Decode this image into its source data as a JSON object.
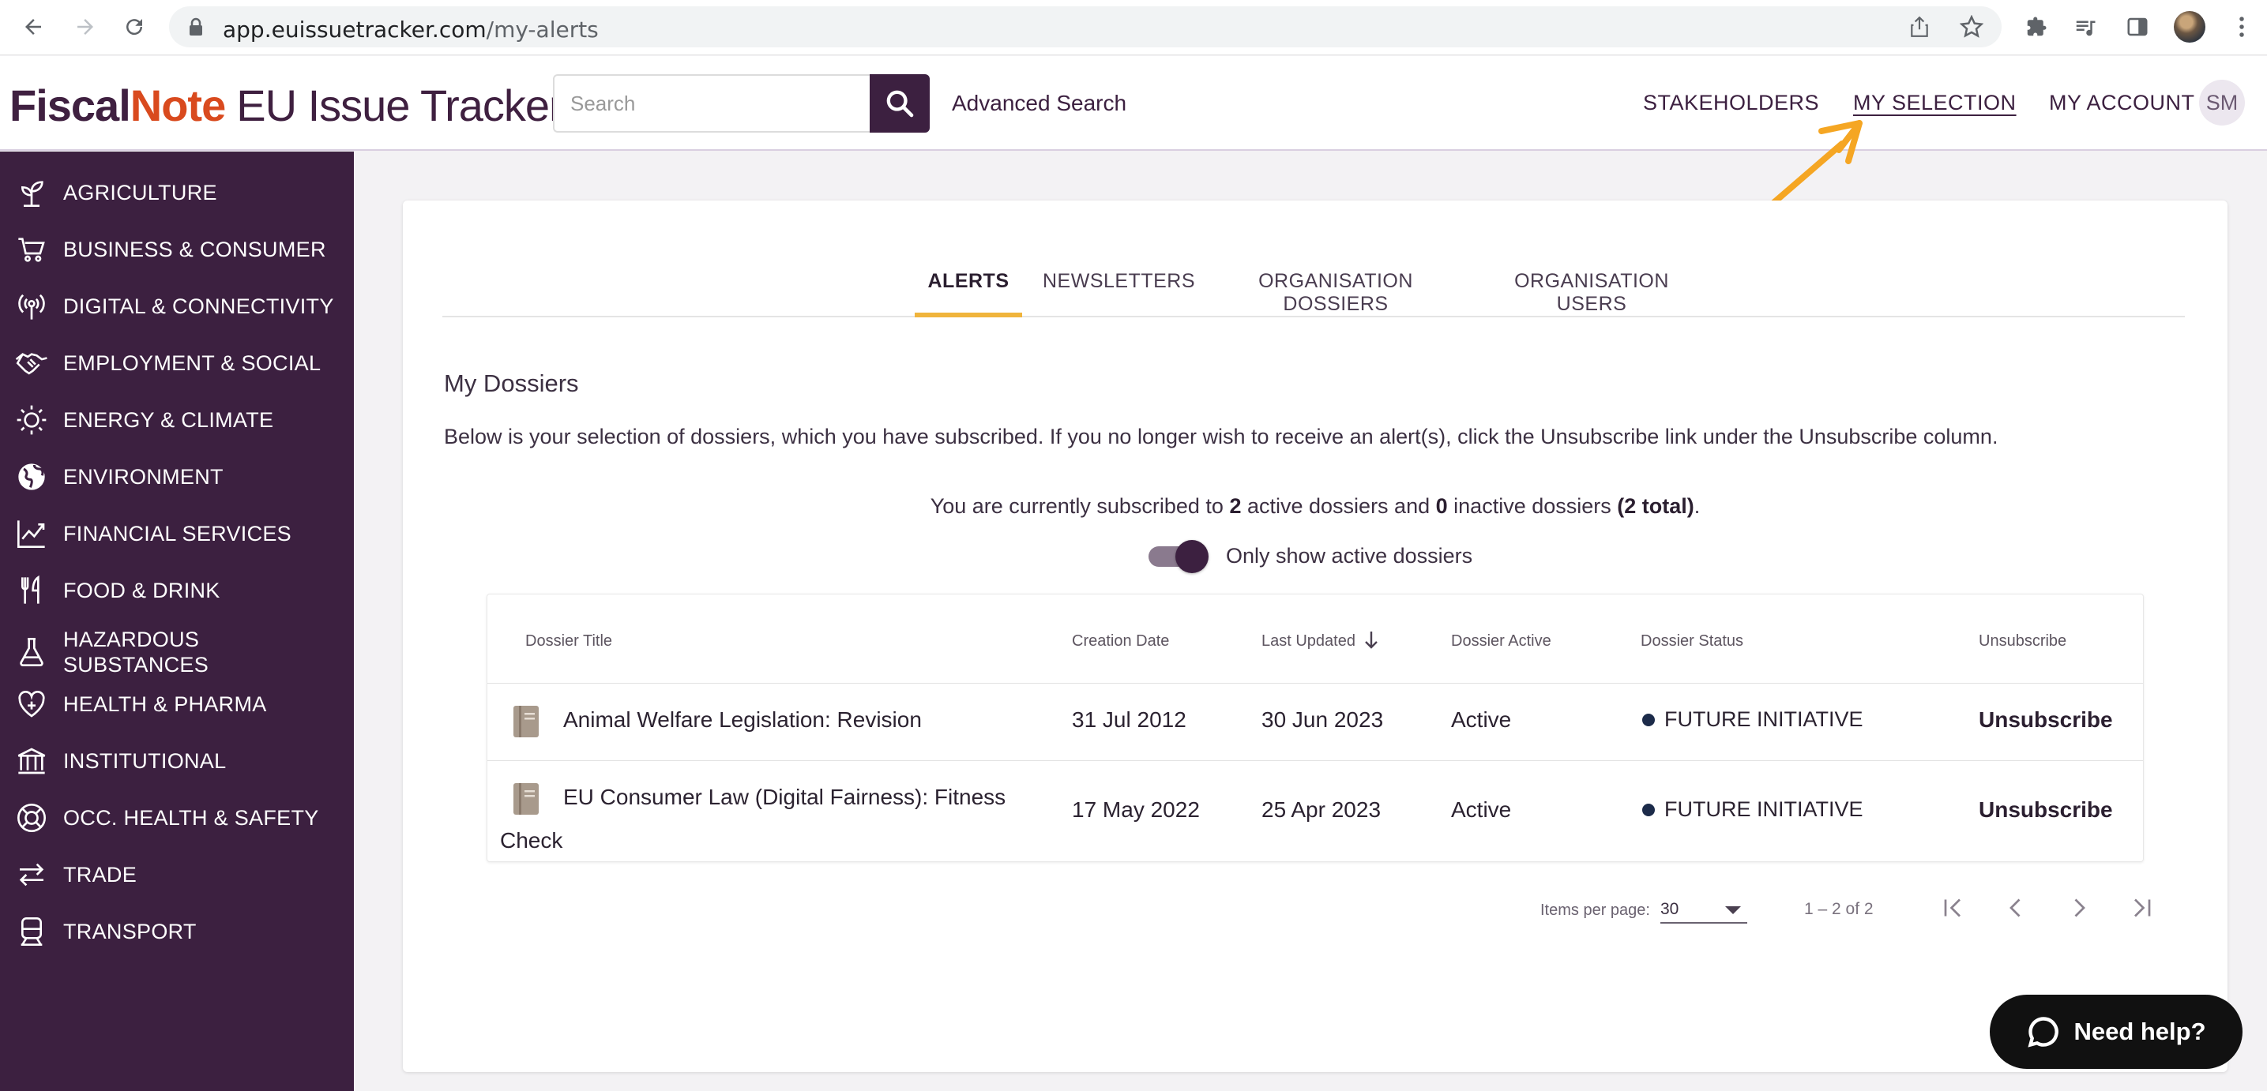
{
  "browser": {
    "url_host": "app.euissuetracker.com",
    "url_path": "/my-alerts"
  },
  "header": {
    "logo_fiscal": "Fiscal",
    "logo_note": "Note",
    "logo_rest": "EU Issue Tracker",
    "search_placeholder": "Search",
    "advanced_search": "Advanced Search",
    "nav": {
      "stakeholders": "STAKEHOLDERS",
      "my_selection": "MY SELECTION",
      "my_account": "MY ACCOUNT"
    },
    "avatar_initials": "SM"
  },
  "sidebar": {
    "items": [
      {
        "label": "AGRICULTURE",
        "icon": "sprout-icon"
      },
      {
        "label": "BUSINESS & CONSUMER",
        "icon": "cart-icon"
      },
      {
        "label": "DIGITAL & CONNECTIVITY",
        "icon": "broadcast-icon"
      },
      {
        "label": "EMPLOYMENT & SOCIAL",
        "icon": "handshake-icon"
      },
      {
        "label": "ENERGY & CLIMATE",
        "icon": "sun-gear-icon"
      },
      {
        "label": "ENVIRONMENT",
        "icon": "globe-icon"
      },
      {
        "label": "FINANCIAL SERVICES",
        "icon": "chart-icon"
      },
      {
        "label": "FOOD & DRINK",
        "icon": "cutlery-icon"
      },
      {
        "label": "HAZARDOUS SUBSTANCES",
        "icon": "flask-icon"
      },
      {
        "label": "HEALTH & PHARMA",
        "icon": "heart-plus-icon"
      },
      {
        "label": "INSTITUTIONAL",
        "icon": "building-icon"
      },
      {
        "label": "OCC. HEALTH & SAFETY",
        "icon": "lifebuoy-icon"
      },
      {
        "label": "TRADE",
        "icon": "exchange-arrows-icon"
      },
      {
        "label": "TRANSPORT",
        "icon": "train-icon"
      }
    ]
  },
  "tabs": [
    {
      "label": "ALERTS",
      "active": true
    },
    {
      "label": "NEWSLETTERS",
      "active": false
    },
    {
      "label": "ORGANISATION DOSSIERS",
      "active": false
    },
    {
      "label": "ORGANISATION USERS",
      "active": false
    }
  ],
  "content": {
    "title": "My Dossiers",
    "description": "Below is your selection of dossiers, which you have subscribed. If you no longer wish to receive an alert(s), click the Unsubscribe link under the Unsubscribe column.",
    "summary": {
      "prefix": "You are currently subscribed to",
      "active_count": "2",
      "active_text": "active dossiers and",
      "inactive_count": "0",
      "inactive_text": "inactive dossiers",
      "total": "(2 total)",
      "suffix": "."
    },
    "toggle_label": "Only show active dossiers",
    "toggle_on": true
  },
  "table": {
    "columns": [
      "Dossier Title",
      "Creation Date",
      "Last Updated",
      "Dossier Active",
      "Dossier Status",
      "Unsubscribe"
    ],
    "rows": [
      {
        "title_line1": "Animal Welfare Legislation: Revision",
        "title_line2": "",
        "creation_date": "31 Jul 2012",
        "last_updated": "30 Jun 2023",
        "active": "Active",
        "status": "FUTURE INITIATIVE",
        "unsubscribe": "Unsubscribe"
      },
      {
        "title_line1": "EU Consumer Law (Digital Fairness): Fitness",
        "title_line2": "Check",
        "creation_date": "17 May 2022",
        "last_updated": "25 Apr 2023",
        "active": "Active",
        "status": "FUTURE INITIATIVE",
        "unsubscribe": "Unsubscribe"
      }
    ]
  },
  "pagination": {
    "items_per_page_label": "Items per page:",
    "items_per_page": "30",
    "range": "1 – 2 of 2"
  },
  "help": {
    "label": "Need help?"
  },
  "colors": {
    "brand_purple": "#3c2040",
    "brand_orange": "#d94a1e",
    "tab_accent": "#f0b43c",
    "annotation_arrow": "#f5a623"
  }
}
